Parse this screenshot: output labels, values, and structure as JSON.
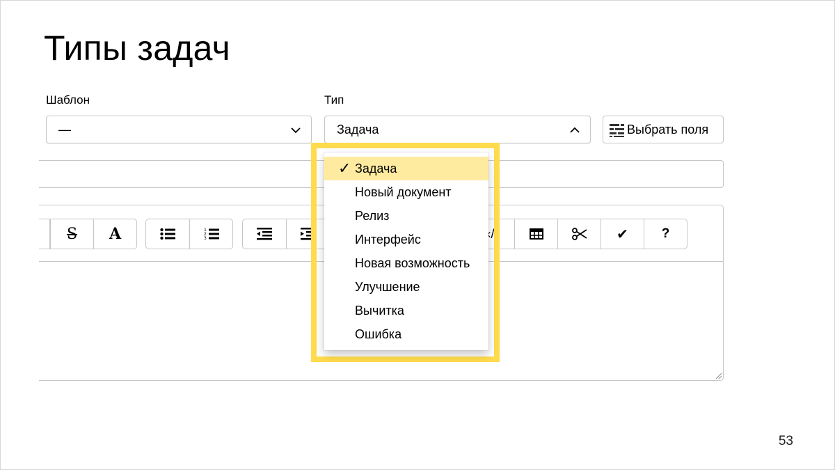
{
  "slide": {
    "title": "Типы задач",
    "page_number": "53"
  },
  "form": {
    "template_label": "Шаблон",
    "template_value": "—",
    "type_label": "Тип",
    "type_value": "Задача",
    "select_fields_label": "Выбрать поля"
  },
  "toolbar": {
    "icons": [
      "strikethrough-icon",
      "text-color-icon",
      "bulleted-list-icon",
      "numbered-list-icon",
      "outdent-icon",
      "indent-icon",
      "code-icon",
      "table-icon",
      "cut-icon",
      "checkmark-icon",
      "help-icon"
    ],
    "strikethrough_glyph": "S",
    "text_glyph": "A",
    "check_glyph": "✔",
    "help_glyph": "?",
    "code_glyph": "‹/›"
  },
  "dropdown": {
    "check_glyph": "✓",
    "options": [
      "Задача",
      "Новый документ",
      "Релиз",
      "Интерфейс",
      "Новая возможность",
      "Улучшение",
      "Вычитка",
      "Ошибка"
    ],
    "selected_index": 0
  },
  "colors": {
    "highlight": "#ffdb4d",
    "selected_option": "#ffeba0",
    "border": "#c6c6c6"
  }
}
